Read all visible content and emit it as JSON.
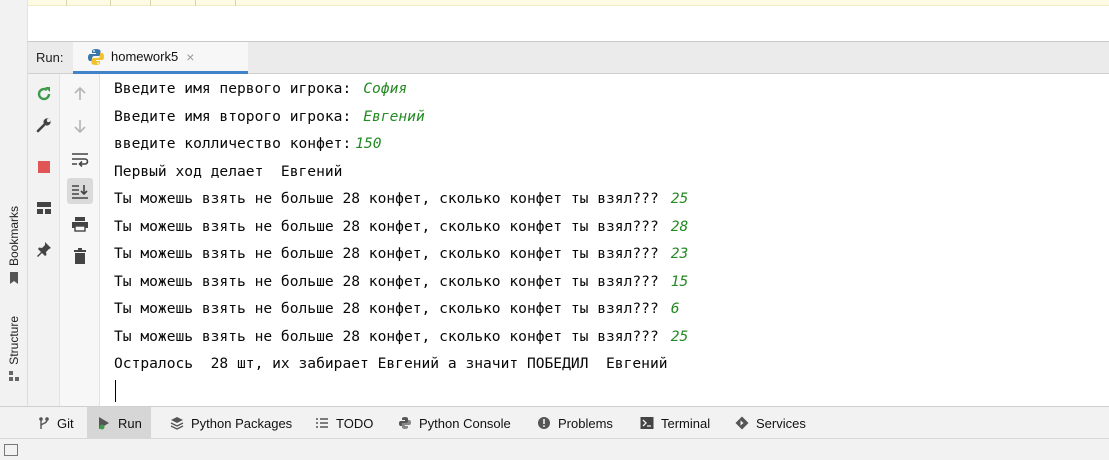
{
  "run_window": {
    "label": "Run:",
    "tab_name": "homework5",
    "close_glyph": "×"
  },
  "side_tabs": {
    "bookmarks": "Bookmarks",
    "structure": "Structure"
  },
  "console": {
    "lines": [
      {
        "text": "Введите имя первого игрока:",
        "input": "София"
      },
      {
        "text": "Введите имя второго игрока:",
        "input": "Евгений"
      },
      {
        "text": "введите колличество конфет:",
        "input": "150"
      },
      {
        "text": "Первый ход делает  Евгений",
        "input": ""
      },
      {
        "text": "Ты можешь взять не больше 28 конфет, сколько конфет ты взял???",
        "input": "25"
      },
      {
        "text": "Ты можешь взять не больше 28 конфет, сколько конфет ты взял???",
        "input": "28"
      },
      {
        "text": "Ты можешь взять не больше 28 конфет, сколько конфет ты взял???",
        "input": "23"
      },
      {
        "text": "Ты можешь взять не больше 28 конфет, сколько конфет ты взял???",
        "input": "15"
      },
      {
        "text": "Ты можешь взять не больше 28 конфет, сколько конфет ты взял???",
        "input": "6"
      },
      {
        "text": "Ты можешь взять не больше 28 конфет, сколько конфет ты взял???",
        "input": "25"
      },
      {
        "text": "Остралось  28 шт, их забирает Евгений а значит ПОБЕДИЛ  Евгений",
        "input": ""
      }
    ]
  },
  "bottom_tabs": {
    "git": "Git",
    "run": "Run",
    "python_packages": "Python Packages",
    "todo": "TODO",
    "python_console": "Python Console",
    "problems": "Problems",
    "terminal": "Terminal",
    "services": "Services"
  },
  "colors": {
    "input_text": "#248a24",
    "accent": "#4083c9",
    "stop": "#e05555",
    "rerun": "#3d9b4b"
  },
  "icons": [
    "rerun-icon",
    "wrench-icon",
    "stop-icon",
    "layout-icon",
    "pin-icon",
    "up-arrow-icon",
    "down-arrow-icon",
    "soft-wrap-icon",
    "scroll-to-end-icon",
    "print-icon",
    "trash-icon",
    "python-icon"
  ]
}
